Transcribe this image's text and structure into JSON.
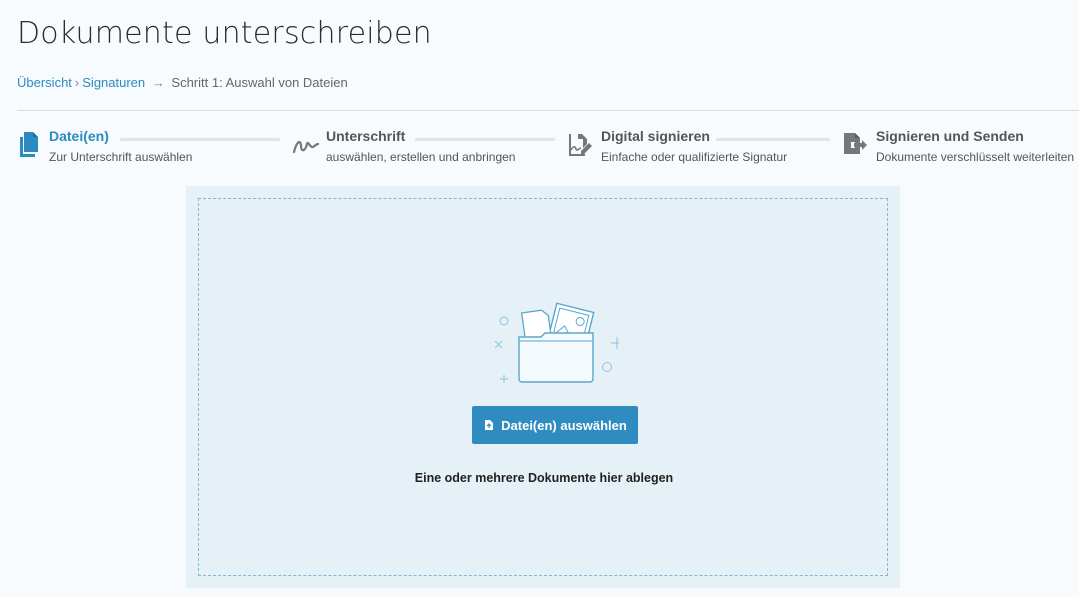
{
  "page": {
    "title": "Dokumente unterschreiben"
  },
  "breadcrumb": {
    "items": [
      "Übersicht",
      "Signaturen"
    ],
    "separator": "›",
    "arrow": "→",
    "current": "Schritt 1: Auswahl von Dateien"
  },
  "steps": [
    {
      "title": "Datei(en)",
      "subtitle": "Zur Unterschrift auswählen",
      "icon": "files-icon",
      "active": true
    },
    {
      "title": "Unterschrift",
      "subtitle": "auswählen, erstellen und anbringen",
      "icon": "signature-icon",
      "active": false
    },
    {
      "title": "Digital signieren",
      "subtitle": "Einfache oder qualifizierte Signatur",
      "icon": "digital-sign-icon",
      "active": false
    },
    {
      "title": "Signieren und Senden",
      "subtitle": "Dokumente verschlüsselt weiterleiten",
      "icon": "send-document-icon",
      "active": false
    }
  ],
  "dropzone": {
    "button_label": "Datei(en) auswählen",
    "hint": "Eine oder mehrere Dokumente hier ablegen",
    "illustration": "folder-with-documents-illustration"
  },
  "colors": {
    "accent": "#2e8cc0",
    "link": "#2a8bbf",
    "step_inactive": "#555555",
    "dropzone_bg": "#e6f1f7"
  }
}
